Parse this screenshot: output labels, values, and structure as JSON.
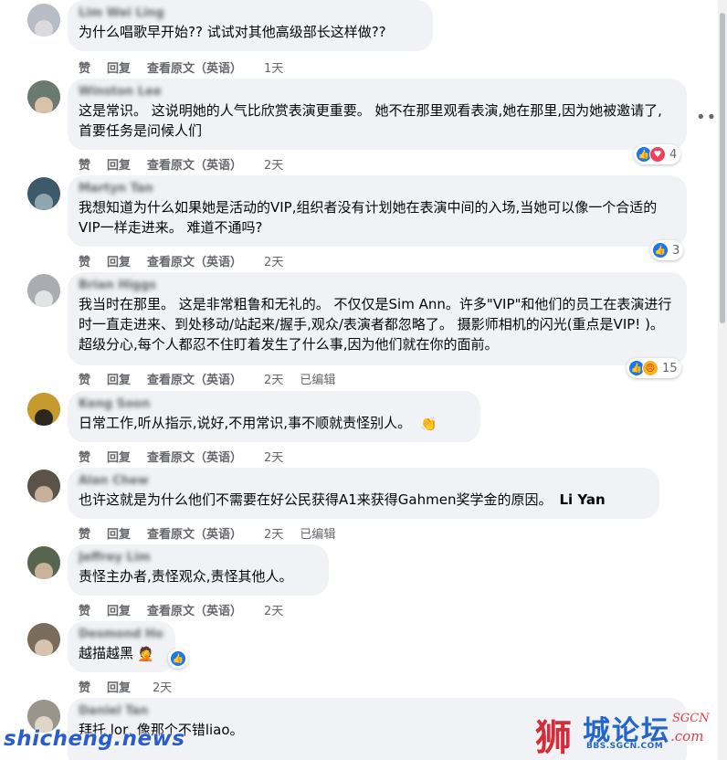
{
  "actions": {
    "like": "赞",
    "reply": "回复",
    "see_original": "查看原文（英语）",
    "edited": "已编辑"
  },
  "comments": [
    {
      "author": "Lim Wei Ling",
      "text": "为什么唱歌早开始?? 试试对其他高级部长这样做??",
      "time": "1天",
      "avatar_color": "#b8bcc4"
    },
    {
      "author": "Winston Lee",
      "text": "这是常识。 这说明她的人气比欣赏表演更重要。 她不在那里观看表演,她在那里,因为她被邀请了,首要任务是问候人们",
      "time": "2天",
      "reaction_count": "4",
      "avatar_color": "#6b7a70"
    },
    {
      "author": "Martyn Tan",
      "text": "我想知道为什么如果她是活动的VIP,组织者没有计划她在表演中间的入场,当她可以像一个合适的VIP一样走进来。 难道不通吗?",
      "time": "2天",
      "reaction_count": "3",
      "avatar_color": "#3d5a6b"
    },
    {
      "author": "Brian Higgs",
      "text": "我当时在那里。 这是非常粗鲁和无礼的。 不仅仅是Sim Ann。许多\"VIP\"和他们的员工在表演进行时一直走进来、到处移动/站起来/握手,观众/表演者都忽略了。 摄影师相机的闪光(重点是VIP! )。 超级分心,每个人都忍不住盯着发生了什么事,因为他们就在你的面前。",
      "time": "2天",
      "reaction_count": "15",
      "avatar_color": "#a9acb0"
    },
    {
      "author": "Keng Soon",
      "text": "日常工作,听从指示,说好,不用常识,事不顺就责怪别人。",
      "emoji": "👏",
      "time": "2天",
      "avatar_color": "#c79a2e"
    },
    {
      "author": "Alan Chew",
      "text": "也许这就是为什么他们不需要在好公民获得A1来获得Gahmen奖学金的原因。",
      "tag": "Li Yan",
      "time": "2天",
      "avatar_color": "#5c5348"
    },
    {
      "author": "Jeffrey Lim",
      "text": "责怪主办者,责怪观众,责怪其他人。",
      "time": "2天",
      "avatar_color": "#566450"
    },
    {
      "author": "Desmond Ho",
      "text": "越描越黑",
      "emoji": "🤦",
      "time": "2天",
      "avatar_color": "#7a6b5a"
    },
    {
      "author": "Daniel Tan",
      "text": "拜托 lor, 像那个不错liao。",
      "avatar_color": "#9a958c"
    }
  ],
  "watermark": {
    "left": "shicheng.news",
    "glyph": "狮",
    "site": "城论坛",
    "url": "BBS.SGCN.COM",
    "sgcn": "SGCN",
    ".com": ".com"
  },
  "icons": {
    "more": "more-horizontal-icon",
    "like": "like-reaction-icon",
    "love": "love-reaction-icon",
    "angry": "angry-reaction-icon"
  },
  "colors": {
    "bubble": "#f0f2f5",
    "secondary_text": "#65676b",
    "like_blue": "#1877f2",
    "love_red": "#f33e58",
    "watermark_blue": "#2266cc",
    "watermark_red": "#d42d3a"
  }
}
